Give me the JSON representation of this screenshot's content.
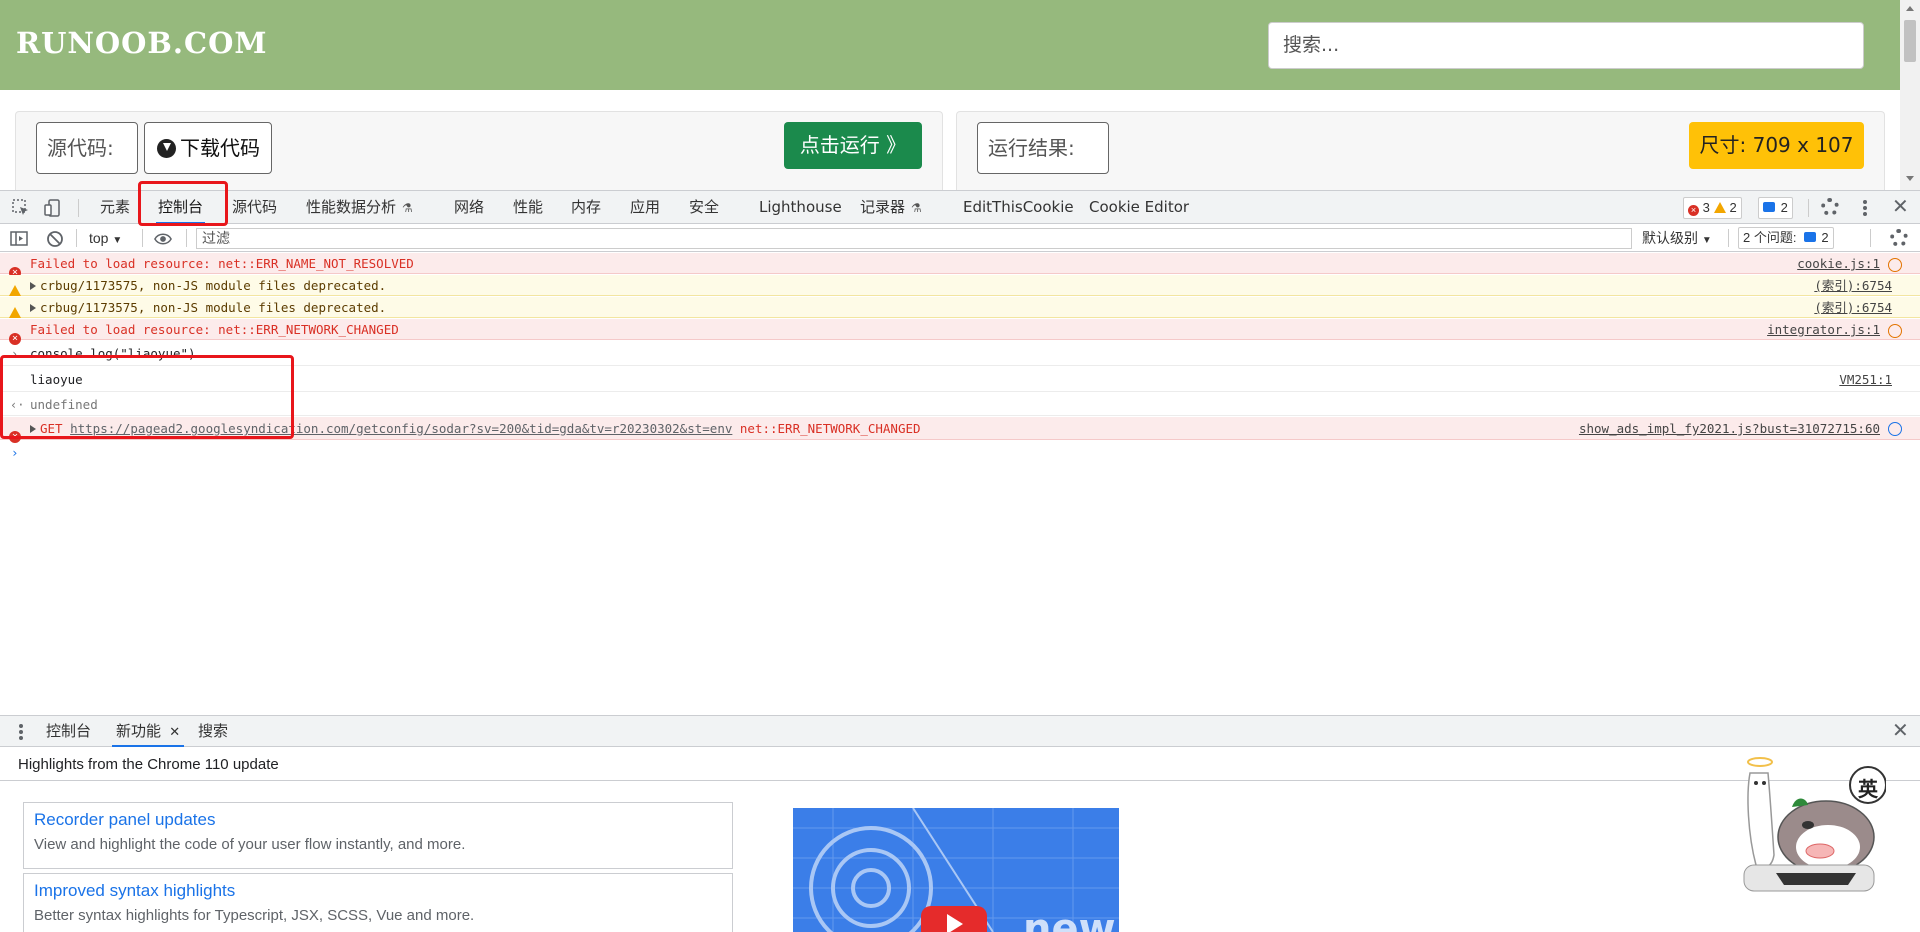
{
  "site": {
    "logo": "RUNOOB.COM",
    "search_placeholder": "搜索...",
    "source_label": "源代码:",
    "download_label": "下载代码",
    "run_label": "点击运行 》",
    "result_label": "运行结果:",
    "size_label": "尺寸: 709 x 107"
  },
  "devtools": {
    "tabs": [
      "元素",
      "控制台",
      "源代码",
      "性能数据分析",
      "网络",
      "性能",
      "内存",
      "应用",
      "安全",
      "Lighthouse",
      "记录器",
      "EditThisCookie",
      "Cookie Editor"
    ],
    "active_tab": "控制台",
    "badge_errors": "3",
    "badge_warnings": "2",
    "badge_messages": "2",
    "toolbar": {
      "context": "top",
      "filter_placeholder": "过滤",
      "level": "默认级别",
      "issues_label": "2 个问题:",
      "issues_count": "2"
    },
    "console_rows": [
      {
        "type": "error",
        "text": "Failed to load resource: net::ERR_NAME_NOT_RESOLVED",
        "source": "cookie.js:1"
      },
      {
        "type": "warning",
        "text": "crbug/1173575, non-JS module files deprecated.",
        "source": "(索引):6754"
      },
      {
        "type": "warning",
        "text": "crbug/1173575, non-JS module files deprecated.",
        "source": "(索引):6754"
      },
      {
        "type": "error",
        "text": "Failed to load resource: net::ERR_NETWORK_CHANGED",
        "source": "integrator.js:1"
      },
      {
        "type": "input",
        "text": "console.log(\"liaoyue\")",
        "source": ""
      },
      {
        "type": "log",
        "text": "liaoyue",
        "source": "VM251:1"
      },
      {
        "type": "result",
        "text": "undefined",
        "source": ""
      },
      {
        "type": "error",
        "method": "GET",
        "url": "https://pagead2.googlesyndication.com/getconfig/sodar?sv=200&tid=gda&tv=r20230302&st=env",
        "text": "net::ERR_NETWORK_CHANGED",
        "source": "show_ads_impl_fy2021.js?bust=31072715:60"
      }
    ],
    "drawer": {
      "tabs": [
        "控制台",
        "新功能",
        "搜索"
      ],
      "active_tab": "新功能",
      "heading": "Highlights from the Chrome 110 update",
      "cards": [
        {
          "title": "Recorder panel updates",
          "desc": "View and highlight the code of your user flow instantly, and more."
        },
        {
          "title": "Improved syntax highlights",
          "desc": "Better syntax highlights for Typescript, JSX, SCSS, Vue and more."
        }
      ],
      "video_text": "new"
    },
    "mascot_text": "英"
  },
  "colors": {
    "header_green": "#96b97d",
    "run_green": "#1b8a4c",
    "size_yellow": "#ffc107",
    "accent_blue": "#1a73e8",
    "error_red": "#d93025",
    "highlight_red": "#e8161b"
  }
}
